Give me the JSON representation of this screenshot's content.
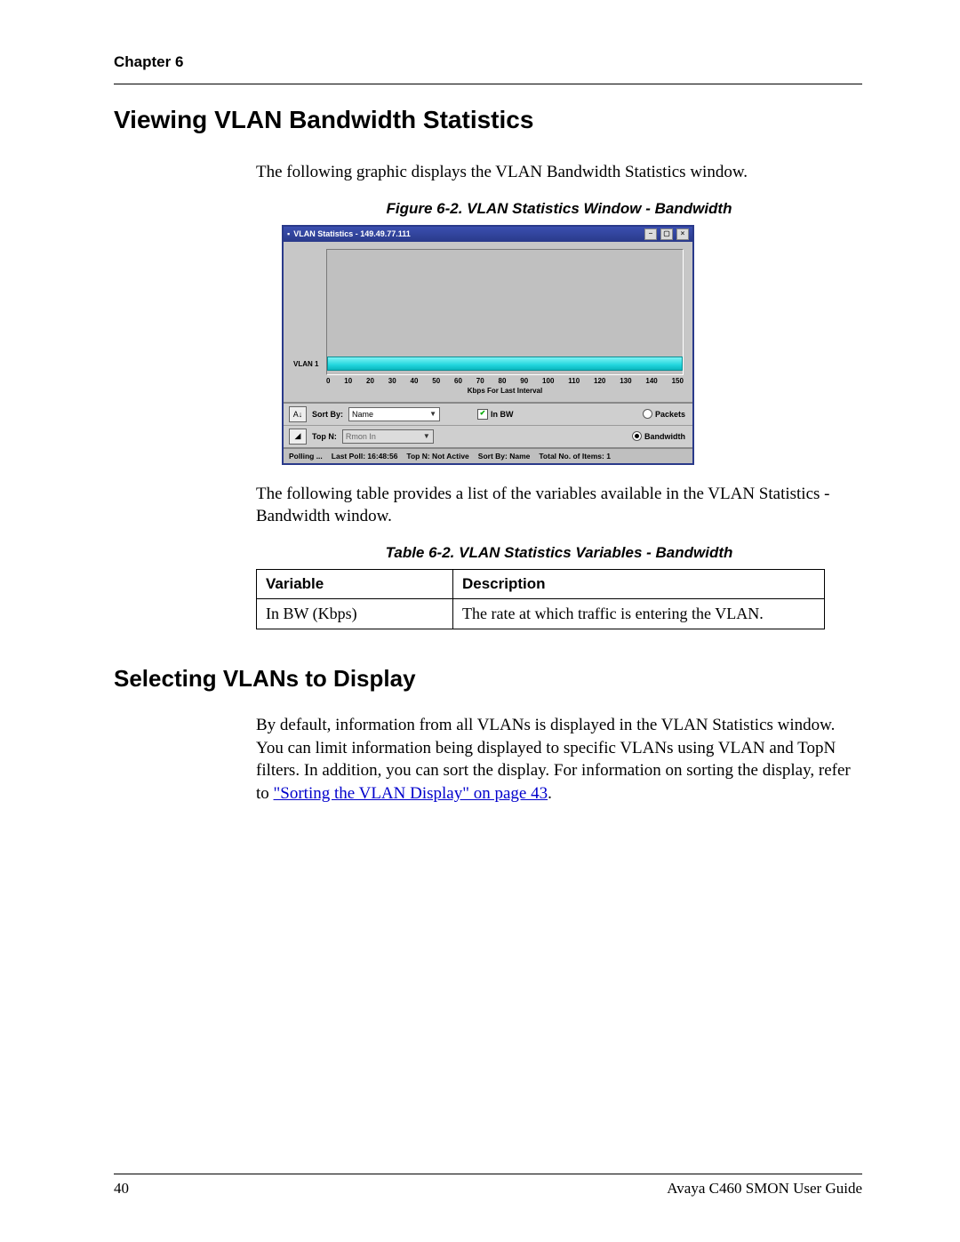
{
  "header": {
    "chapter": "Chapter 6"
  },
  "section1": {
    "title": "Viewing VLAN Bandwidth Statistics",
    "intro": "The following graphic displays the VLAN Bandwidth Statistics window.",
    "figure_caption": "Figure 6-2.  VLAN Statistics Window - Bandwidth",
    "after_figure": "The following table provides a list of the variables available in the VLAN Statistics - Bandwidth window.",
    "table_caption": "Table 6-2.  VLAN Statistics Variables - Bandwidth",
    "table": {
      "headers": [
        "Variable",
        "Description"
      ],
      "rows": [
        [
          "In BW (Kbps)",
          "The rate at which traffic is entering the VLAN."
        ]
      ]
    }
  },
  "section2": {
    "title": "Selecting VLANs to Display",
    "body_pre": "By default, information from all VLANs is displayed in the VLAN Statistics window. You can limit information being displayed to specific VLANs using VLAN and TopN filters. In addition, you can sort the display. For information on sorting the display, refer to ",
    "link_text": "\"Sorting the VLAN Display\" on page 43",
    "body_post": "."
  },
  "footer": {
    "page": "40",
    "doc": "Avaya C460 SMON User Guide"
  },
  "widget": {
    "title": "VLAN Statistics - 149.49.77.111",
    "ylabel": "VLAN 1",
    "xlabel": "Kbps For Last Interval",
    "sort_by_label": "Sort By:",
    "sort_by_value": "Name",
    "topn_label": "Top N:",
    "topn_value": "Rmon In",
    "checkbox_label": "In BW",
    "radio1": "Packets",
    "radio2": "Bandwidth",
    "status": {
      "polling": "Polling ...",
      "last_poll": "Last Poll: 16:48:56",
      "topn": "Top N: Not Active",
      "sort": "Sort By: Name",
      "items": "Total No. of Items: 1"
    }
  },
  "chart_data": {
    "type": "bar",
    "orientation": "horizontal",
    "categories": [
      "VLAN 1"
    ],
    "values": [
      150
    ],
    "xlabel": "Kbps For Last Interval",
    "ylabel": "",
    "xlim": [
      0,
      150
    ],
    "x_ticks": [
      0,
      10,
      20,
      30,
      40,
      50,
      60,
      70,
      80,
      90,
      100,
      110,
      120,
      130,
      140,
      150
    ],
    "title": "VLAN Statistics - 149.49.77.111"
  }
}
